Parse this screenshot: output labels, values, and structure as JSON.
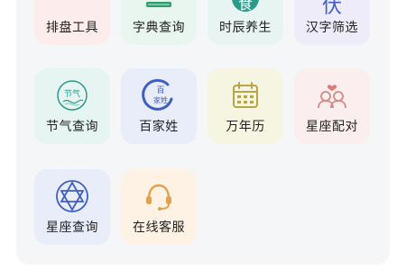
{
  "colors": {
    "accent_green": "#2f9e6e",
    "accent_teal": "#2a9a8a",
    "accent_blue": "#3f5fc0",
    "accent_yellow": "#b8a44a",
    "accent_rose": "#d08a86",
    "accent_orange": "#e0a24a"
  },
  "grid": {
    "items": [
      {
        "label": "排盘工具",
        "icon": "bagua-icon"
      },
      {
        "label": "字典查询",
        "icon": "book-icon"
      },
      {
        "label": "时辰养生",
        "icon": "seal-character-icon",
        "icon_text": "食"
      },
      {
        "label": "汉字筛选",
        "icon": "calligraphy-icon",
        "icon_text": "伏"
      },
      {
        "label": "节气查询",
        "icon": "solar-term-badge-icon",
        "icon_text": "节气"
      },
      {
        "label": "百家姓",
        "icon": "surname-circle-icon",
        "icon_text": "百\n家姓"
      },
      {
        "label": "万年历",
        "icon": "calendar-icon"
      },
      {
        "label": "星座配对",
        "icon": "couple-heart-icon"
      },
      {
        "label": "星座查询",
        "icon": "hexagram-star-icon"
      },
      {
        "label": "在线客服",
        "icon": "headset-icon"
      }
    ]
  }
}
